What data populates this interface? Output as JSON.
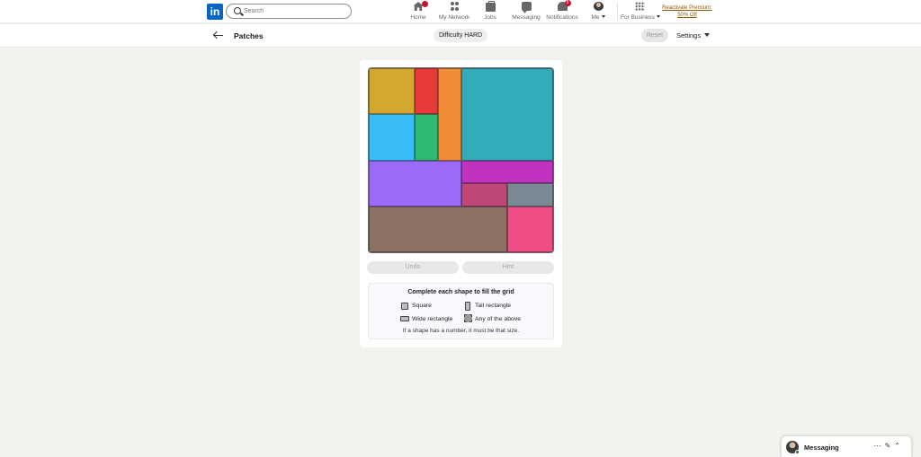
{
  "nav": {
    "logo": "in",
    "search_placeholder": "Search",
    "items": [
      {
        "label": "Home",
        "icon": "home-icon"
      },
      {
        "label": "My Network",
        "icon": "network-icon"
      },
      {
        "label": "Jobs",
        "icon": "briefcase-icon"
      },
      {
        "label": "Messaging",
        "icon": "chat-icon"
      },
      {
        "label": "Notifications",
        "icon": "bell-icon",
        "badge": "5"
      },
      {
        "label": "Me",
        "icon": "avatar"
      },
      {
        "label": "For Business",
        "icon": "grid-icon"
      }
    ],
    "premium_line1": "Reactivate Premium:",
    "premium_line2": "50% Off"
  },
  "subbar": {
    "title": "Patches",
    "difficulty": "Difficulty HARD",
    "reset": "Reset",
    "settings": "Settings"
  },
  "board": {
    "grid_size": 6,
    "patches": [
      {
        "name": "patch-gold",
        "color": "#d4a82e",
        "row": 0,
        "col": 0,
        "rows": 1.5,
        "cols": 1.5
      },
      {
        "name": "patch-red",
        "color": "#e83a3a",
        "row": 0,
        "col": 1.5,
        "rows": 1.5,
        "cols": 0.75
      },
      {
        "name": "patch-orange",
        "color": "#f28b36",
        "row": 0,
        "col": 2.25,
        "rows": 3,
        "cols": 0.75
      },
      {
        "name": "patch-teal",
        "color": "#33abb8",
        "row": 0,
        "col": 3,
        "rows": 3,
        "cols": 3
      },
      {
        "name": "patch-sky",
        "color": "#38bdf8",
        "row": 1.5,
        "col": 0,
        "rows": 1.5,
        "cols": 1.5
      },
      {
        "name": "patch-green",
        "color": "#2eb872",
        "row": 1.5,
        "col": 1.5,
        "rows": 1.5,
        "cols": 0.75
      },
      {
        "name": "patch-violet",
        "color": "#9b6bf7",
        "row": 3,
        "col": 0,
        "rows": 1.5,
        "cols": 3
      },
      {
        "name": "patch-magenta",
        "color": "#bf33bf",
        "row": 3,
        "col": 3,
        "rows": 0.75,
        "cols": 3
      },
      {
        "name": "patch-raspberry",
        "color": "#c0477a",
        "row": 3.75,
        "col": 3,
        "rows": 0.75,
        "cols": 1.5
      },
      {
        "name": "patch-slate",
        "color": "#798a94",
        "row": 3.75,
        "col": 4.5,
        "rows": 0.75,
        "cols": 1.5
      },
      {
        "name": "patch-brown",
        "color": "#8b7166",
        "row": 4.5,
        "col": 0,
        "rows": 1.5,
        "cols": 4.5
      },
      {
        "name": "patch-pink",
        "color": "#ef4d86",
        "row": 4.5,
        "col": 4.5,
        "rows": 1.5,
        "cols": 1.5
      }
    ]
  },
  "controls": {
    "undo": "Undo",
    "hint": "Hint"
  },
  "legend": {
    "title": "Complete each shape to fill the grid",
    "square": "Square",
    "tall": "Tall rectangle",
    "wide": "Wide rectangle",
    "any": "Any of the above",
    "note": "If a shape has a number, it must be that size."
  },
  "messaging": {
    "label": "Messaging",
    "icons": [
      "more-icon",
      "compose-icon",
      "chevron-up-icon"
    ]
  }
}
